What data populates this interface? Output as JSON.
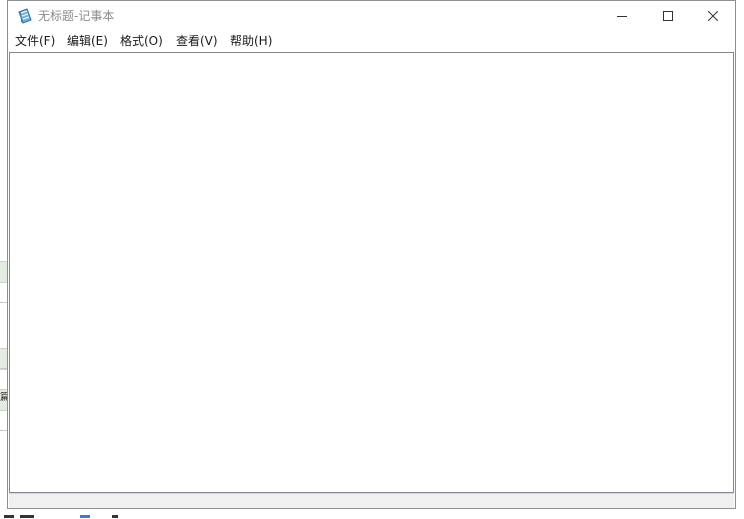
{
  "window": {
    "title": "无标题-记事本",
    "icon": "notepad-icon",
    "controls": {
      "minimize_icon": "minimize-icon",
      "maximize_icon": "maximize-icon",
      "close_icon": "close-icon"
    }
  },
  "menu": {
    "items": [
      {
        "label": "文件(F)"
      },
      {
        "label": "编辑(E)"
      },
      {
        "label": "格式(O)"
      },
      {
        "label": "查看(V)"
      },
      {
        "label": "帮助(H)"
      }
    ]
  },
  "editor": {
    "content": ""
  },
  "background": {
    "partial_char": "篇"
  },
  "colors": {
    "title_text": "#8a8a8a",
    "window_border": "#8f8f8f",
    "status_bar": "#f0f0f0"
  }
}
